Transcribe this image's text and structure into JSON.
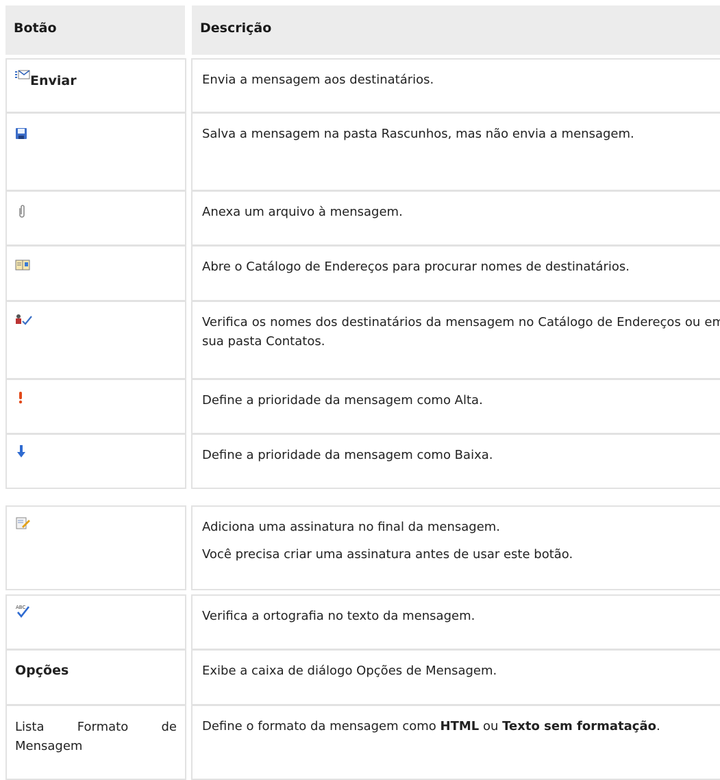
{
  "table": {
    "headers": {
      "button": "Botão",
      "description": "Descrição"
    },
    "rows": [
      {
        "icon": "send-envelope-icon",
        "button_label": "Enviar",
        "desc": "Envia a mensagem aos destinatários."
      },
      {
        "icon": "save-floppy-icon",
        "desc": "Salva a mensagem na pasta Rascunhos, mas não envia a mensagem."
      },
      {
        "icon": "paperclip-icon",
        "desc": "Anexa um arquivo à mensagem."
      },
      {
        "icon": "address-book-icon",
        "desc": "Abre o Catálogo de Endereços para procurar nomes de destinatários."
      },
      {
        "icon": "check-names-icon",
        "desc": "Verifica os nomes dos destinatários da mensagem no Catálogo de Endereços ou em sua pasta Contatos."
      },
      {
        "icon": "high-priority-icon",
        "desc": "Define a prioridade da mensagem como Alta."
      },
      {
        "icon": "low-priority-icon",
        "desc": "Define a prioridade da mensagem como Baixa."
      },
      {
        "icon": "signature-icon",
        "desc": "Adiciona uma assinatura no final da mensagem.",
        "desc2": "Você precisa criar uma assinatura antes de usar este botão."
      },
      {
        "icon": "spell-check-icon",
        "desc": "Verifica a ortografia no texto da mensagem."
      },
      {
        "button_label": "Opções",
        "desc": "Exibe a caixa de diálogo Opções de Mensagem."
      },
      {
        "button_label": "Lista Formato de Mensagem",
        "desc_prefix": "Define o formato da mensagem como ",
        "desc_bold1": "HTML",
        "desc_mid": " ou ",
        "desc_bold2": "Texto sem formatação",
        "desc_suffix": "."
      }
    ]
  }
}
